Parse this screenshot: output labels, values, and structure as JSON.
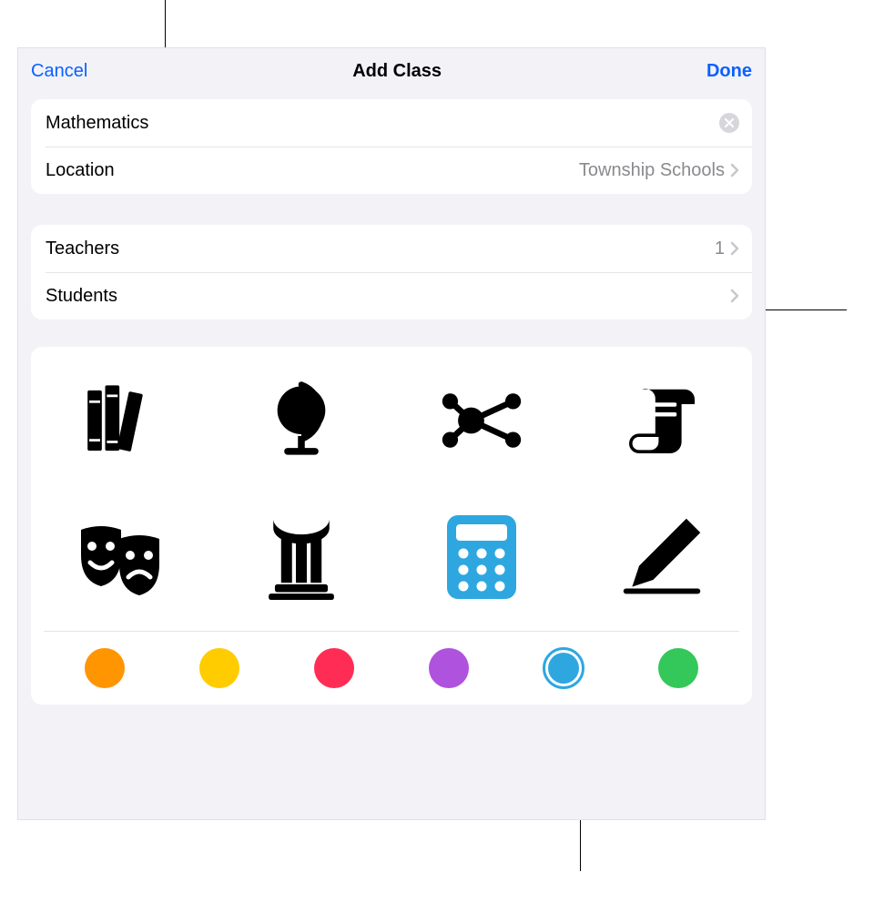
{
  "header": {
    "cancel_label": "Cancel",
    "title": "Add Class",
    "done_label": "Done"
  },
  "class_info": {
    "name_value": "Mathematics",
    "location_label": "Location",
    "location_value": "Township Schools"
  },
  "people": {
    "teachers_label": "Teachers",
    "teachers_count": "1",
    "students_label": "Students",
    "students_count": ""
  },
  "icons": [
    {
      "name": "books-icon",
      "selected": false
    },
    {
      "name": "globe-icon",
      "selected": false
    },
    {
      "name": "molecule-icon",
      "selected": false
    },
    {
      "name": "scroll-icon",
      "selected": false
    },
    {
      "name": "drama-masks-icon",
      "selected": false
    },
    {
      "name": "column-icon",
      "selected": false
    },
    {
      "name": "calculator-icon",
      "selected": true
    },
    {
      "name": "pencil-icon",
      "selected": false
    }
  ],
  "colors": [
    {
      "name": "orange",
      "hex": "#ff9500",
      "selected": false
    },
    {
      "name": "yellow",
      "hex": "#ffcc00",
      "selected": false
    },
    {
      "name": "pink",
      "hex": "#ff2d55",
      "selected": false
    },
    {
      "name": "purple",
      "hex": "#af52de",
      "selected": false
    },
    {
      "name": "blue",
      "hex": "#2ea7e0",
      "selected": true
    },
    {
      "name": "green",
      "hex": "#34c759",
      "selected": false
    }
  ]
}
